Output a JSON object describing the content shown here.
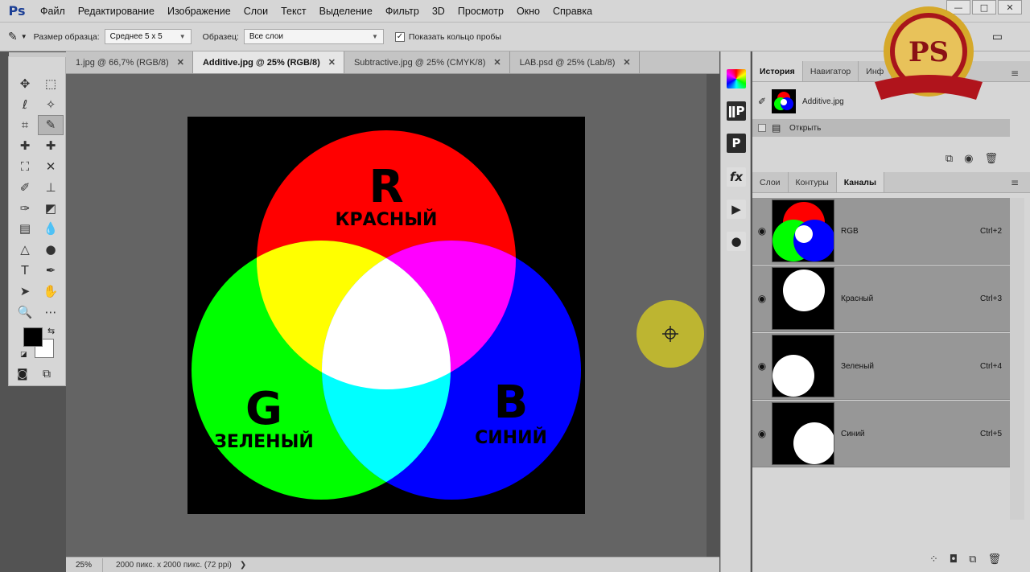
{
  "app": {
    "logo": "Ps",
    "menu": [
      "Файл",
      "Редактирование",
      "Изображение",
      "Слои",
      "Текст",
      "Выделение",
      "Фильтр",
      "3D",
      "Просмотр",
      "Окно",
      "Справка"
    ],
    "window_buttons": [
      "—",
      "□",
      "✕"
    ]
  },
  "options_bar": {
    "sample_size_label": "Размер образца:",
    "sample_size_value": "Среднее 5 x 5",
    "sample_label": "Образец:",
    "sample_value": "Все слои",
    "show_ring_label": "Показать кольцо пробы",
    "show_ring_checked": "✓"
  },
  "tabs": [
    {
      "label": "1.jpg @ 66,7% (RGB/8)",
      "close": "✕"
    },
    {
      "label": "Additive.jpg @ 25% (RGB/8)",
      "close": "✕",
      "active": true
    },
    {
      "label": "Subtractive.jpg @ 25% (CMYK/8)",
      "close": "✕"
    },
    {
      "label": "LAB.psd @ 25% (Lab/8)",
      "close": "✕"
    }
  ],
  "canvas": {
    "r_letter": "R",
    "r_word": "КРАСНЫЙ",
    "g_letter": "G",
    "g_word": "ЗЕЛЕНЫЙ",
    "b_letter": "B",
    "b_word": "СИНИЙ",
    "colors": {
      "red": "#ff0000",
      "green": "#00ff00",
      "blue": "#0000ff",
      "yellow": "#ffff00",
      "magenta": "#ff00ff",
      "cyan": "#00ffff",
      "white": "#ffffff"
    }
  },
  "status": {
    "zoom": "25%",
    "doc_info": "2000 пикс. x 2000 пикс. (72 ppi)",
    "arrow": "❯"
  },
  "dock": {
    "icons": [
      "color-wheel-icon",
      "paragraph-icon",
      "character-icon",
      "fx-icon",
      "play-icon",
      "adjust-icon"
    ],
    "labels": [
      "",
      "ǁP",
      "P",
      "fx",
      "▶",
      "●"
    ]
  },
  "history_panel": {
    "tabs": [
      "История",
      "Навигатор",
      "Инф"
    ],
    "snapshot_label": "Additive.jpg",
    "step_label": "Открыть"
  },
  "channels_panel": {
    "tabs": [
      "Слои",
      "Контуры",
      "Каналы"
    ],
    "rows": [
      {
        "name": "RGB",
        "shortcut": "Ctrl+2"
      },
      {
        "name": "Красный",
        "shortcut": "Ctrl+3"
      },
      {
        "name": "Зеленый",
        "shortcut": "Ctrl+4"
      },
      {
        "name": "Синий",
        "shortcut": "Ctrl+5"
      }
    ]
  },
  "badge": {
    "text": "PS",
    "colors": {
      "gold": "#c9a227",
      "ribbon": "#b0141c"
    }
  }
}
